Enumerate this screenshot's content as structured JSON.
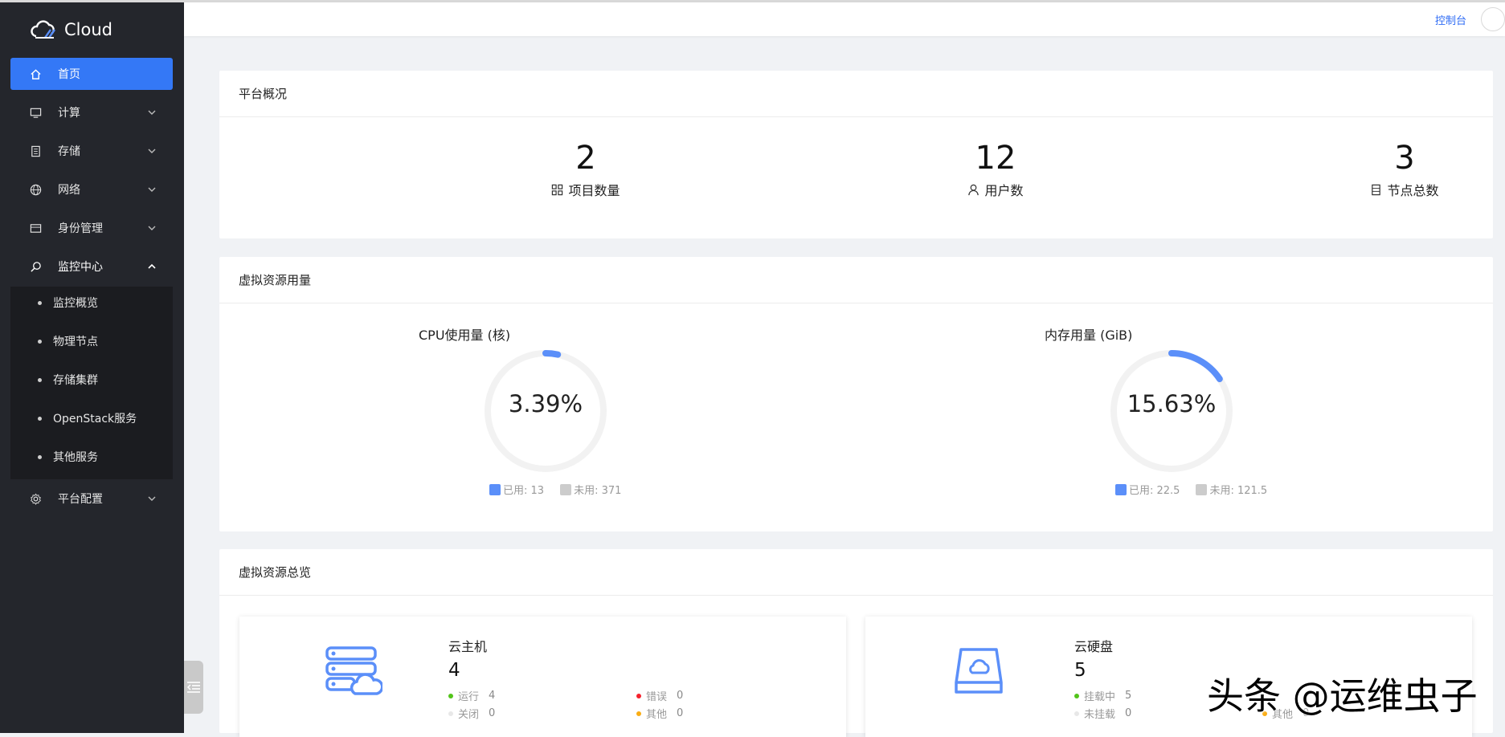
{
  "app": {
    "logo_text": "Cloud"
  },
  "header": {
    "console_link": "控制台"
  },
  "sidebar": {
    "items": [
      {
        "label": "首页",
        "icon": "home-icon",
        "active": true
      },
      {
        "label": "计算",
        "icon": "monitor-icon"
      },
      {
        "label": "存储",
        "icon": "storage-icon"
      },
      {
        "label": "网络",
        "icon": "globe-icon"
      },
      {
        "label": "身份管理",
        "icon": "id-card-icon"
      },
      {
        "label": "监控中心",
        "icon": "monitor-search-icon",
        "expanded": true
      },
      {
        "label": "平台配置",
        "icon": "gear-icon"
      }
    ],
    "submenu": [
      "监控概览",
      "物理节点",
      "存储集群",
      "OpenStack服务",
      "其他服务"
    ]
  },
  "overview": {
    "title": "平台概况",
    "stats": [
      {
        "value": "2",
        "label": "项目数量",
        "icon": "project-icon"
      },
      {
        "value": "12",
        "label": "用户数",
        "icon": "user-icon"
      },
      {
        "value": "3",
        "label": "节点总数",
        "icon": "node-icon"
      }
    ]
  },
  "usage": {
    "title": "虚拟资源用量",
    "cpu": {
      "title": "CPU使用量 (核)",
      "percent_text": "3.39%",
      "percent": 3.39,
      "used_label": "已用: 13",
      "free_label": "未用: 371"
    },
    "mem": {
      "title": "内存用量 (GiB)",
      "percent_text": "15.63%",
      "percent": 15.63,
      "used_label": "已用: 22.5",
      "free_label": "未用: 121.5"
    }
  },
  "resources": {
    "title": "虚拟资源总览",
    "vm": {
      "name": "云主机",
      "count": "4",
      "stats": [
        {
          "label": "运行",
          "value": "4",
          "color": "#52c41a"
        },
        {
          "label": "错误",
          "value": "0",
          "color": "#f5222d"
        },
        {
          "label": "关闭",
          "value": "0",
          "color": "#e8e8e8"
        },
        {
          "label": "其他",
          "value": "0",
          "color": "#faad14"
        }
      ]
    },
    "disk": {
      "name": "云硬盘",
      "count": "5",
      "stats": [
        {
          "label": "挂载中",
          "value": "5",
          "color": "#52c41a"
        },
        {
          "label": "未挂载",
          "value": "0",
          "color": "#e8e8e8"
        },
        {
          "label": "其他",
          "value": "0",
          "color": "#faad14"
        }
      ]
    }
  },
  "colors": {
    "accent": "#3478f6",
    "gauge_used": "#5b8ff9",
    "gauge_track": "#f2f2f2",
    "legend_free": "#cccccc",
    "sidebar_bg": "#24262c"
  },
  "watermark": "头条 @运维虫子"
}
